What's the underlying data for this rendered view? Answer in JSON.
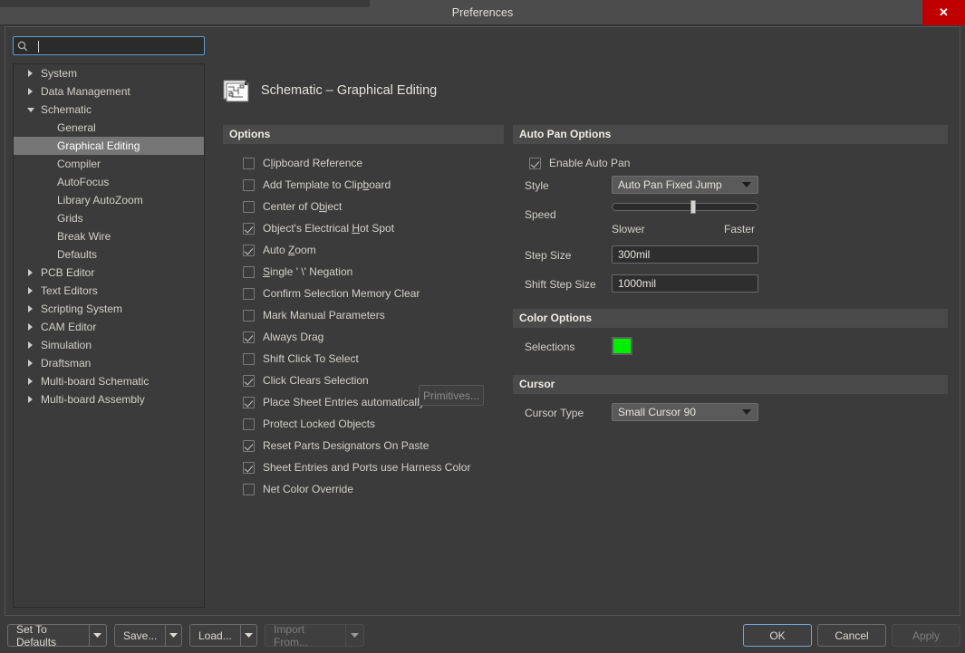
{
  "window": {
    "title": "Preferences",
    "close_label": "✕"
  },
  "search": {
    "placeholder": "",
    "value": "",
    "icon": "search-icon"
  },
  "sidebar": {
    "items": [
      {
        "label": "System",
        "level": 0,
        "expandable": true,
        "expanded": false,
        "selected": false
      },
      {
        "label": "Data Management",
        "level": 0,
        "expandable": true,
        "expanded": false,
        "selected": false
      },
      {
        "label": "Schematic",
        "level": 0,
        "expandable": true,
        "expanded": true,
        "selected": false
      },
      {
        "label": "General",
        "level": 1,
        "expandable": false,
        "expanded": false,
        "selected": false
      },
      {
        "label": "Graphical Editing",
        "level": 1,
        "expandable": false,
        "expanded": false,
        "selected": true
      },
      {
        "label": "Compiler",
        "level": 1,
        "expandable": false,
        "expanded": false,
        "selected": false
      },
      {
        "label": "AutoFocus",
        "level": 1,
        "expandable": false,
        "expanded": false,
        "selected": false
      },
      {
        "label": "Library AutoZoom",
        "level": 1,
        "expandable": false,
        "expanded": false,
        "selected": false
      },
      {
        "label": "Grids",
        "level": 1,
        "expandable": false,
        "expanded": false,
        "selected": false
      },
      {
        "label": "Break Wire",
        "level": 1,
        "expandable": false,
        "expanded": false,
        "selected": false
      },
      {
        "label": "Defaults",
        "level": 1,
        "expandable": false,
        "expanded": false,
        "selected": false
      },
      {
        "label": "PCB Editor",
        "level": 0,
        "expandable": true,
        "expanded": false,
        "selected": false
      },
      {
        "label": "Text Editors",
        "level": 0,
        "expandable": true,
        "expanded": false,
        "selected": false
      },
      {
        "label": "Scripting System",
        "level": 0,
        "expandable": true,
        "expanded": false,
        "selected": false
      },
      {
        "label": "CAM Editor",
        "level": 0,
        "expandable": true,
        "expanded": false,
        "selected": false
      },
      {
        "label": "Simulation",
        "level": 0,
        "expandable": true,
        "expanded": false,
        "selected": false
      },
      {
        "label": "Draftsman",
        "level": 0,
        "expandable": true,
        "expanded": false,
        "selected": false
      },
      {
        "label": "Multi-board Schematic",
        "level": 0,
        "expandable": true,
        "expanded": false,
        "selected": false
      },
      {
        "label": "Multi-board Assembly",
        "level": 0,
        "expandable": true,
        "expanded": false,
        "selected": false
      }
    ]
  },
  "page": {
    "icon": "schematic-document-icon",
    "title": "Schematic – Graphical Editing"
  },
  "options_section": {
    "header": "Options",
    "primitives_button": "Primitives...",
    "checkboxes": [
      {
        "label": "Clipboard Reference",
        "checked": false,
        "accel_index": 1
      },
      {
        "label": "Add Template to Clipboard",
        "checked": false,
        "accel_index": 20
      },
      {
        "label": "Center of Object",
        "checked": false,
        "accel_index": 11
      },
      {
        "label": "Object's Electrical Hot Spot",
        "checked": true,
        "accel_index": 20
      },
      {
        "label": "Auto Zoom",
        "checked": true,
        "accel_index": 5
      },
      {
        "label": "Single ' \\' Negation",
        "checked": false,
        "accel_index": 0
      },
      {
        "label": "Confirm Selection Memory Clear",
        "checked": false,
        "accel_index": -1
      },
      {
        "label": "Mark Manual Parameters",
        "checked": false,
        "accel_index": -1
      },
      {
        "label": "Always Drag",
        "checked": true,
        "accel_index": -1
      },
      {
        "label": "Shift Click To Select",
        "checked": false,
        "accel_index": -1
      },
      {
        "label": "Click Clears Selection",
        "checked": true,
        "accel_index": -1
      },
      {
        "label": "Place Sheet Entries automatically",
        "checked": true,
        "accel_index": -1
      },
      {
        "label": "Protect Locked Objects",
        "checked": false,
        "accel_index": -1
      },
      {
        "label": "Reset Parts Designators On Paste",
        "checked": true,
        "accel_index": -1
      },
      {
        "label": "Sheet Entries and Ports use Harness Color",
        "checked": true,
        "accel_index": -1
      },
      {
        "label": "Net Color Override",
        "checked": false,
        "accel_index": -1
      }
    ]
  },
  "autopan_section": {
    "header": "Auto Pan Options",
    "enable_label": "Enable Auto Pan",
    "enable_checked": true,
    "style_label": "Style",
    "style_value": "Auto Pan Fixed Jump",
    "speed_label": "Speed",
    "speed_percent": 55,
    "speed_min_label": "Slower",
    "speed_max_label": "Faster",
    "step_size_label": "Step Size",
    "step_size_value": "300mil",
    "shift_step_size_label": "Shift Step Size",
    "shift_step_size_value": "1000mil"
  },
  "color_section": {
    "header": "Color Options",
    "selections_label": "Selections",
    "selections_color": "#00ee00"
  },
  "cursor_section": {
    "header": "Cursor",
    "cursor_type_label": "Cursor Type",
    "cursor_type_value": "Small Cursor 90"
  },
  "footer": {
    "set_to_defaults": "Set To Defaults",
    "save": "Save...",
    "load": "Load...",
    "import_from": "Import From...",
    "ok": "OK",
    "cancel": "Cancel",
    "apply": "Apply"
  },
  "colors": {
    "accent_focus": "#6fa8dc",
    "selection_green": "#00ee00",
    "close_red": "#c00000",
    "section_header_bg": "#4a4a4a",
    "window_bg": "#3b3b3b"
  }
}
